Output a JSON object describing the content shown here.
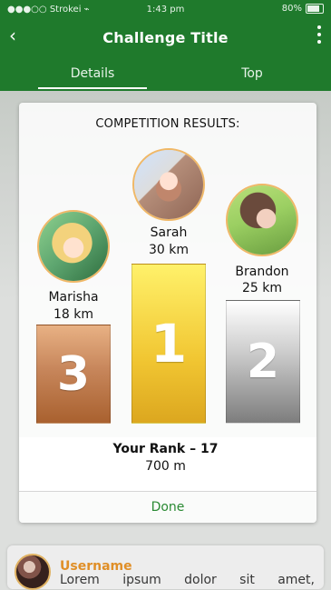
{
  "status_bar": {
    "carrier": "Strokei",
    "time": "1:43 pm",
    "battery": "80%"
  },
  "header": {
    "title": "Challenge Title",
    "tabs": [
      {
        "label": "Details",
        "active": true
      },
      {
        "label": "Top",
        "active": false
      }
    ]
  },
  "modal": {
    "title": "COMPETITION RESULTS:",
    "podium": [
      {
        "place": "1",
        "name": "Sarah",
        "distance": "30 km"
      },
      {
        "place": "2",
        "name": "Brandon",
        "distance": "25 km"
      },
      {
        "place": "3",
        "name": "Marisha",
        "distance": "18 km"
      }
    ],
    "rank": {
      "title": "Your Rank – 17",
      "value": "700 m"
    },
    "done_label": "Done"
  },
  "background_card": {
    "username": "Username",
    "lorem": [
      "Lorem",
      "ipsum",
      "dolor",
      "sit",
      "amet,"
    ]
  },
  "icons": {
    "back": "back-arrow-icon",
    "menu": "kebab-menu-icon",
    "wifi": "wifi-icon",
    "battery": "battery-icon"
  },
  "colors": {
    "header_green": "#1f7a2c",
    "accent_orange": "#f19a2b",
    "done_green": "#2a8a33"
  }
}
